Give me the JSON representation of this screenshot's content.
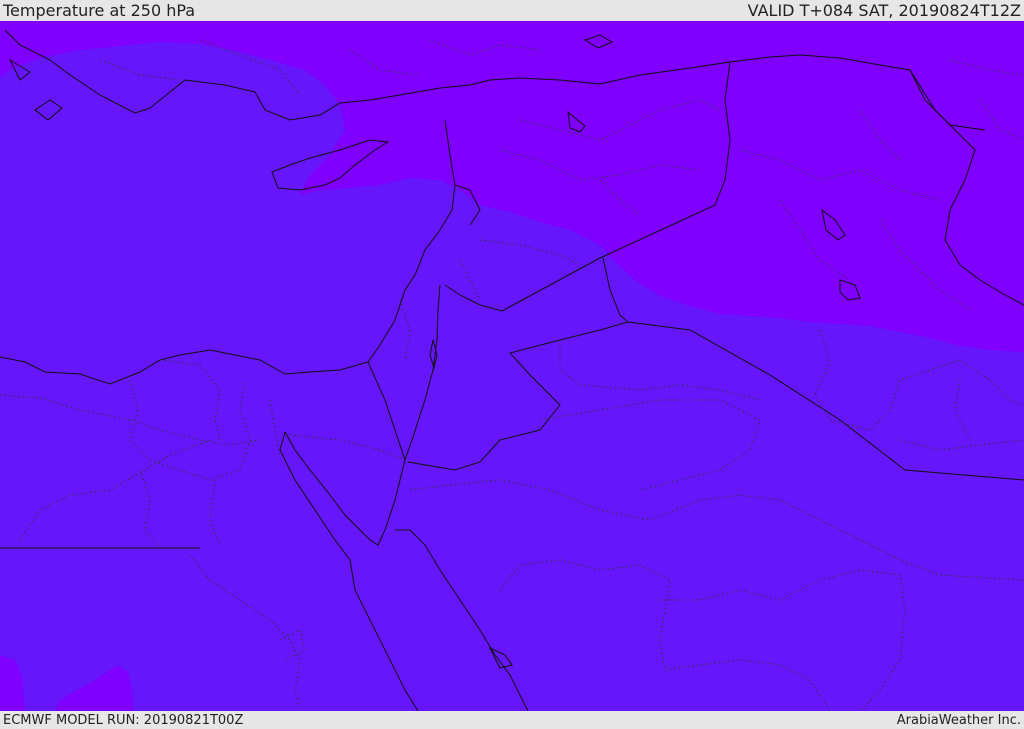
{
  "header": {
    "title": "Temperature at 250 hPa",
    "valid_time": "VALID T+084 SAT, 20190824T12Z"
  },
  "footer": {
    "model_run": "ECMWF MODEL RUN: 20190821T00Z",
    "credit": "ArabiaWeather Inc."
  },
  "map": {
    "colors": {
      "warm_band": "#6616fa",
      "cold_band": "#7f00ff",
      "coastline": "#111111",
      "border": "#111111",
      "province_border": "#333333"
    }
  }
}
